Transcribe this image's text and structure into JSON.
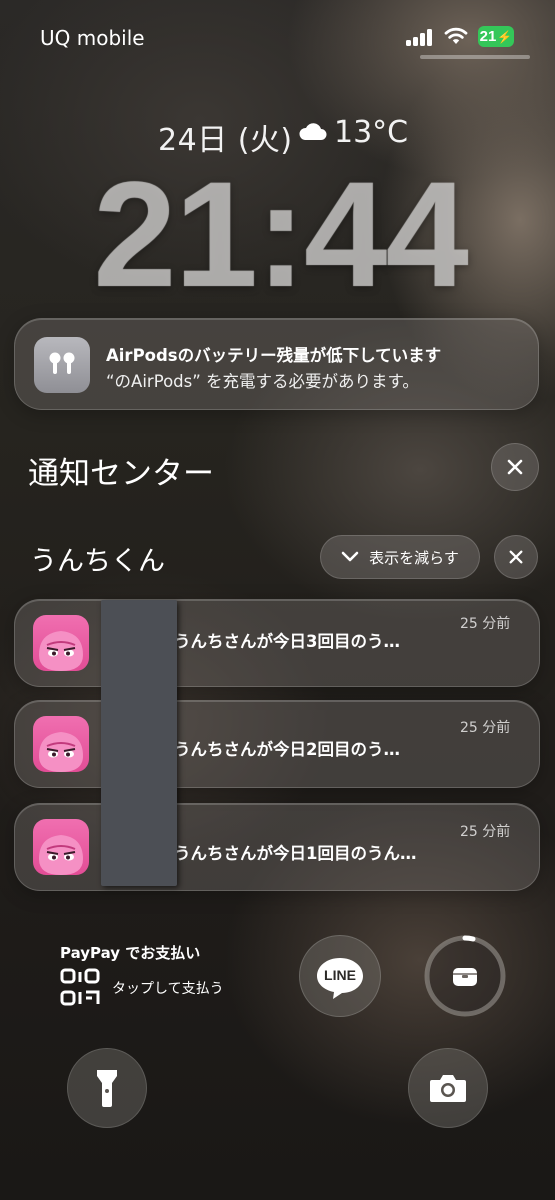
{
  "status_bar": {
    "carrier": "UQ mobile",
    "battery_level": "21",
    "battery_color": "#34c759"
  },
  "lock_screen": {
    "date": "24日 (火)",
    "weather_icon": "cloud-icon",
    "temperature": "13°C",
    "time": "21:44"
  },
  "airpods_alert": {
    "title": "AirPodsのバッテリー残量が低下しています",
    "body": "“のAirPods” を充電する必要があります。"
  },
  "notification_center": {
    "title": "通知センター"
  },
  "group": {
    "app_name": "うんちくん",
    "show_less_label": "表示を減らす",
    "notifications": [
      {
        "text": "うんちさんが今日3回目のう…",
        "time": "25 分前"
      },
      {
        "text": "うんちさんが今日2回目のう…",
        "time": "25 分前"
      },
      {
        "text": "うんちさんが今日1回目のうん…",
        "time": "25 分前"
      }
    ]
  },
  "widgets": {
    "paypay_title": "PayPay でお支払い",
    "paypay_tap": "タップして支払う",
    "line_label": "LINE"
  },
  "accent": {
    "pink_icon": "#e85aa2"
  }
}
